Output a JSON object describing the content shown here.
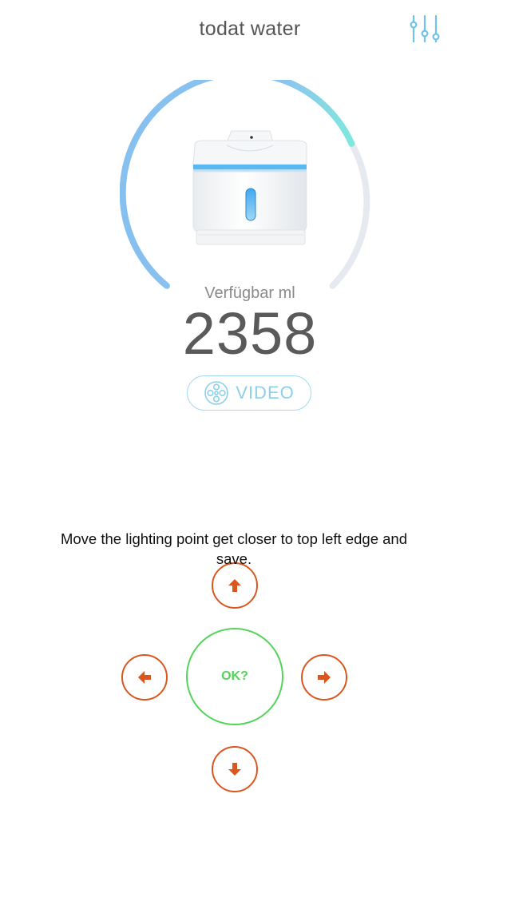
{
  "header": {
    "title": "todat water",
    "settings_icon": "sliders-icon"
  },
  "gauge": {
    "level_fraction": 0.62,
    "colors": {
      "filled": "#86c0ef",
      "filled_end": "#7fe7dd",
      "track": "#e6eaf0"
    }
  },
  "reading": {
    "label": "Verfügbar ml",
    "value": "2358"
  },
  "video_button": {
    "label": "VIDEO",
    "icon": "film-reel-icon",
    "color": "#8dd0ea"
  },
  "calibration": {
    "instruction": "Move the lighting point get closer to top left edge and save.",
    "ok_label": "OK?",
    "arrow_color": "#d9571f",
    "ok_color": "#54d35a",
    "icons": {
      "up": "arrow-up-icon",
      "down": "arrow-down-icon",
      "left": "arrow-left-icon",
      "right": "arrow-right-icon"
    }
  }
}
